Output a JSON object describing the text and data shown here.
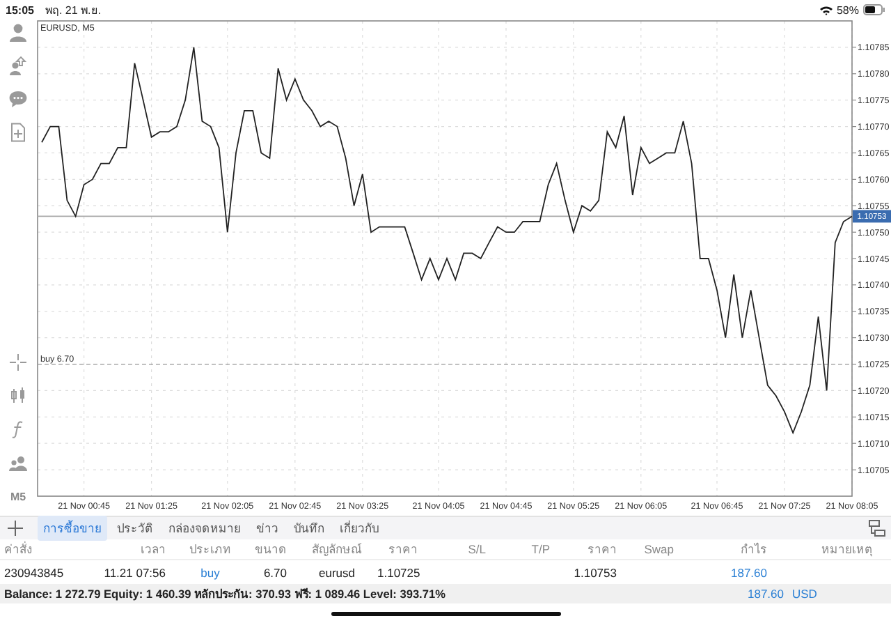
{
  "status_bar": {
    "time": "15:05",
    "date": "พฤ. 21 พ.ย.",
    "battery": "58%"
  },
  "toolbar": {
    "timeframe": "M5"
  },
  "chart": {
    "symbol": "EURUSD, M5",
    "chart_data": {
      "type": "line",
      "categories": [
        null,
        null,
        null,
        null,
        null,
        "21 Nov 00:45",
        null,
        null,
        null,
        null,
        null,
        null,
        null,
        "21 Nov 01:25",
        null,
        null,
        null,
        null,
        null,
        null,
        null,
        null,
        "21 Nov 02:05",
        null,
        null,
        null,
        null,
        null,
        null,
        null,
        "21 Nov 02:45",
        null,
        null,
        null,
        null,
        null,
        null,
        null,
        "21 Nov 03:25",
        null,
        null,
        null,
        null,
        null,
        null,
        null,
        null,
        "21 Nov 04:05",
        null,
        null,
        null,
        null,
        null,
        null,
        null,
        "21 Nov 04:45",
        null,
        null,
        null,
        null,
        null,
        null,
        null,
        "21 Nov 05:25",
        null,
        null,
        null,
        null,
        null,
        null,
        null,
        "21 Nov 06:05",
        null,
        null,
        null,
        null,
        null,
        null,
        null,
        null,
        "21 Nov 06:45",
        null,
        null,
        null,
        null,
        null,
        null,
        null,
        "21 Nov 07:25",
        null,
        null,
        null,
        null,
        null,
        null,
        null,
        "21 Nov 08:05"
      ],
      "series": [
        {
          "color": "#222222",
          "values": [
            1.10767,
            1.1077,
            1.1077,
            1.10756,
            1.10753,
            1.10759,
            1.1076,
            1.10763,
            1.10763,
            1.10766,
            1.10766,
            1.10782,
            1.10775,
            1.10768,
            1.10769,
            1.10769,
            1.1077,
            1.10775,
            1.10785,
            1.10771,
            1.1077,
            1.10766,
            1.1075,
            1.10765,
            1.10773,
            1.10773,
            1.10765,
            1.10764,
            1.10781,
            1.10775,
            1.10779,
            1.10775,
            1.10773,
            1.1077,
            1.10771,
            1.1077,
            1.10764,
            1.10755,
            1.10761,
            1.1075,
            1.10751,
            1.10751,
            1.10751,
            1.10751,
            1.10746,
            1.10741,
            1.10745,
            1.10741,
            1.10745,
            1.10741,
            1.10746,
            1.10746,
            1.10745,
            1.10748,
            1.10751,
            1.1075,
            1.1075,
            1.10752,
            1.10752,
            1.10752,
            1.10759,
            1.10763,
            1.10756,
            1.1075,
            1.10755,
            1.10754,
            1.10756,
            1.10769,
            1.10766,
            1.10772,
            1.10757,
            1.10766,
            1.10763,
            1.10764,
            1.10765,
            1.10765,
            1.10771,
            1.10763,
            1.10745,
            1.10745,
            1.10739,
            1.1073,
            1.10742,
            1.1073,
            1.10739,
            1.1073,
            1.10721,
            1.10719,
            1.10716,
            1.10712,
            1.10716,
            1.10721,
            1.10734,
            1.1072,
            1.10748,
            1.10752,
            1.10753
          ]
        }
      ],
      "ylim": [
        1.107,
        1.1079
      ],
      "yticks": [
        {
          "value": 1.10705,
          "label": "1.10705"
        },
        {
          "value": 1.1071,
          "label": "1.10710"
        },
        {
          "value": 1.10715,
          "label": "1.10715"
        },
        {
          "value": 1.1072,
          "label": "1.10720"
        },
        {
          "value": 1.10725,
          "label": "1.10725"
        },
        {
          "value": 1.1073,
          "label": "1.10730"
        },
        {
          "value": 1.10735,
          "label": "1.10735"
        },
        {
          "value": 1.1074,
          "label": "1.10740"
        },
        {
          "value": 1.10745,
          "label": "1.10745"
        },
        {
          "value": 1.1075,
          "label": "1.10750"
        },
        {
          "value": 1.10755,
          "label": "1.10755"
        },
        {
          "value": 1.1076,
          "label": "1.10760"
        },
        {
          "value": 1.10765,
          "label": "1.10765"
        },
        {
          "value": 1.1077,
          "label": "1.10770"
        },
        {
          "value": 1.10775,
          "label": "1.10775"
        },
        {
          "value": 1.1078,
          "label": "1.10780"
        },
        {
          "value": 1.10785,
          "label": "1.10785"
        }
      ],
      "grid": true,
      "ref_lines": [
        {
          "axis": "y",
          "value": 1.10753,
          "label": "1.10753"
        },
        {
          "axis": "y",
          "value": 1.10725,
          "label": "buy 6.70"
        }
      ]
    }
  },
  "terminal": {
    "tabs": [
      {
        "label": "การซื้อขาย",
        "selected": true
      },
      {
        "label": "ประวัติ",
        "selected": false
      },
      {
        "label": "กล่องจดหมาย",
        "selected": false
      },
      {
        "label": "ข่าว",
        "selected": false
      },
      {
        "label": "บันทึก",
        "selected": false
      },
      {
        "label": "เกี่ยวกับ",
        "selected": false
      }
    ],
    "table": {
      "columns": [
        "ค่าสั่ง",
        "เวลา",
        "ประเภท",
        "ขนาด",
        "สัญลักษณ์",
        "ราคา",
        "S/L",
        "T/P",
        "ราคา",
        "Swap",
        "กำไร",
        "หมายเหตุ"
      ],
      "rows": [
        {
          "cells": [
            "230943845",
            "11.21 07:56",
            "buy",
            "6.70",
            "eurusd",
            "1.10725",
            null,
            null,
            "1.10753",
            null,
            "187.60",
            null
          ]
        }
      ],
      "summary": {
        "text": "Balance: 1 272.79 Equity: 1 460.39 หลักประกัน: 370.93 ฟรี: 1 089.46 Level: 393.71%",
        "profit": "187.60",
        "currency": "USD"
      }
    }
  }
}
